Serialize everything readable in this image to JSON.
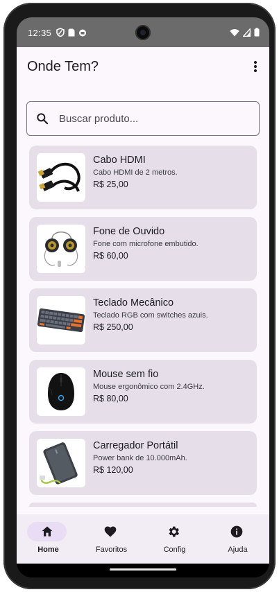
{
  "status_bar": {
    "time": "12:35",
    "left_icons": [
      "shield-icon",
      "sim-card-icon",
      "vpn-icon"
    ],
    "right_icons": [
      "wifi-icon",
      "signal-icon",
      "battery-icon"
    ]
  },
  "app_bar": {
    "title": "Onde Tem?",
    "menu_icon": "more-vert-icon"
  },
  "search": {
    "placeholder": "Buscar produto...",
    "value": "",
    "icon": "search-icon"
  },
  "products": [
    {
      "name": "Cabo HDMI",
      "description": "Cabo HDMI de 2 metros.",
      "price": "R$ 25,00",
      "image": "hdmi-cable"
    },
    {
      "name": "Fone de Ouvido",
      "description": "Fone com microfone embutido.",
      "price": "R$ 60,00",
      "image": "earphones"
    },
    {
      "name": "Teclado Mecânico",
      "description": "Teclado RGB com switches azuis.",
      "price": "R$ 250,00",
      "image": "keyboard"
    },
    {
      "name": "Mouse sem fio",
      "description": "Mouse ergonômico com 2.4GHz.",
      "price": "R$ 80,00",
      "image": "mouse"
    },
    {
      "name": "Carregador Portátil",
      "description": "Power bank de 10.000mAh.",
      "price": "R$ 120,00",
      "image": "power-bank"
    }
  ],
  "bottom_nav": [
    {
      "label": "Home",
      "icon": "home-icon",
      "active": true
    },
    {
      "label": "Favoritos",
      "icon": "heart-icon",
      "active": false
    },
    {
      "label": "Config",
      "icon": "gear-icon",
      "active": false
    },
    {
      "label": "Ajuda",
      "icon": "info-icon",
      "active": false
    }
  ],
  "colors": {
    "app_background": "#fcf7fd",
    "card_background": "#e6dfea",
    "nav_background": "#f2ecf4",
    "nav_active_indicator": "#e9ddf5",
    "status_bar": "#6b6b6b"
  }
}
